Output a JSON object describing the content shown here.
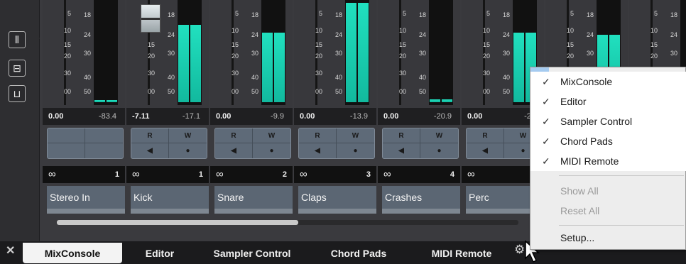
{
  "channels": [
    {
      "name": "Stereo In",
      "volume": "0.00",
      "peak": "-83.4",
      "link_number": "1",
      "meter_level": 0.02
    },
    {
      "name": "Kick",
      "volume": "-7.11",
      "peak": "-17.1",
      "link_number": "1",
      "meter_level": 0.78
    },
    {
      "name": "Snare",
      "volume": "0.00",
      "peak": "-9.9",
      "link_number": "2",
      "meter_level": 0.7
    },
    {
      "name": "Claps",
      "volume": "0.00",
      "peak": "-13.9",
      "link_number": "3",
      "meter_level": 1.0
    },
    {
      "name": "Crashes",
      "volume": "0.00",
      "peak": "-20.9",
      "link_number": "4",
      "meter_level": 0.03
    },
    {
      "name": "Perc",
      "volume": "0.00",
      "peak": "-20",
      "link_number": "",
      "meter_level": 0.7
    },
    {
      "name": "",
      "volume": "",
      "peak": "",
      "link_number": "",
      "meter_level": 0.68
    },
    {
      "name": "",
      "volume": "",
      "peak": "",
      "link_number": "",
      "meter_level": 0.0
    }
  ],
  "scale_left": [
    "5",
    "10",
    "15",
    "20",
    "30",
    "00"
  ],
  "scale_right": [
    "18",
    "24",
    "30",
    "40",
    "50"
  ],
  "rw_labels": {
    "read": "R",
    "write": "W"
  },
  "link_icon": "∞",
  "tabs": [
    {
      "label": "MixConsole",
      "active": true
    },
    {
      "label": "Editor",
      "active": false
    },
    {
      "label": "Sampler Control",
      "active": false
    },
    {
      "label": "Chord Pads",
      "active": false
    },
    {
      "label": "MIDI Remote",
      "active": false
    }
  ],
  "context_menu": {
    "checked_items": [
      "MixConsole",
      "Editor",
      "Sampler Control",
      "Chord Pads",
      "MIDI Remote"
    ],
    "show_all": "Show All",
    "reset_all": "Reset All",
    "setup": "Setup..."
  },
  "colors": {
    "meter": "#21e0bf",
    "selection": "#a5cbf0"
  },
  "scrollbar_position": 0.52
}
